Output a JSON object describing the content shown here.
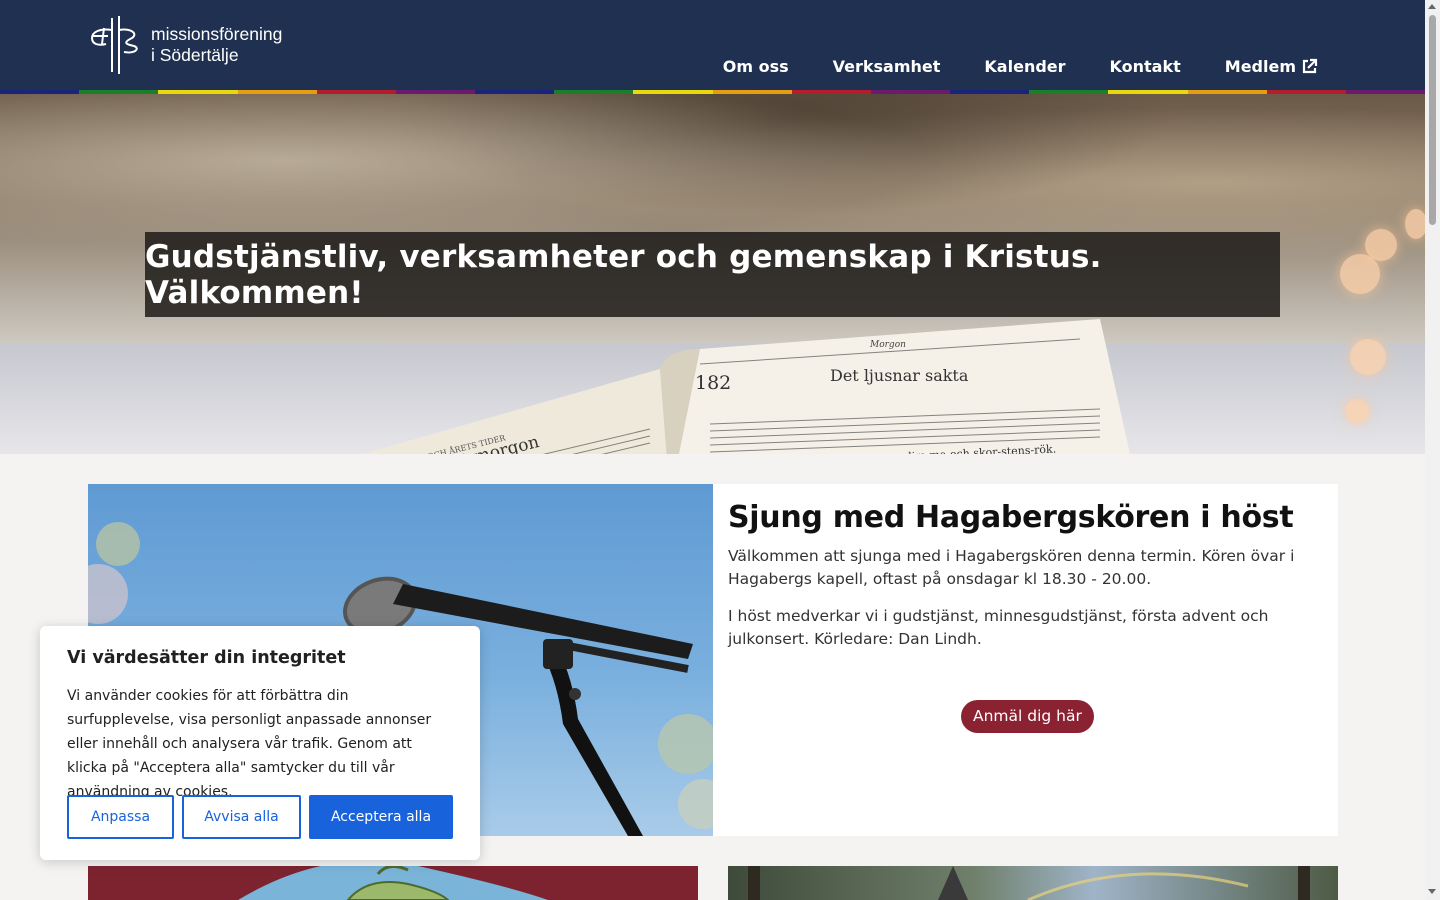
{
  "header": {
    "logo_line1": "missionsförening",
    "logo_line2": "i Södertälje",
    "nav": [
      "Om oss",
      "Verksamhet",
      "Kalender",
      "Kontakt",
      "Medlem"
    ],
    "rainbow_colors": [
      "#1a237e",
      "#1b7f2a",
      "#e9d80d",
      "#e59d12",
      "#b21e2b",
      "#6a1b6e",
      "#1a237e",
      "#1b7f2a",
      "#e9d80d",
      "#e59d12",
      "#b21e2b",
      "#6a1b6e",
      "#1a237e",
      "#1b7f2a",
      "#e9d80d",
      "#e59d12",
      "#b21e2b",
      "#6a1b6e"
    ]
  },
  "hero": {
    "headline": "Gudstjänstliv, verksamheter och gemenskap i Kristus. Välkommen!",
    "book_left_heading": "DAGENS OCH ÅRETS TIDER",
    "book_left_title": "Nu är det morgon",
    "book_right_number": "182",
    "book_right_label": "Morgon",
    "book_right_title": "Det ljusnar sakta",
    "book_right_lyric": "Det ljus-nar sak - ta i-ge-nom dim-ma och skor-stens-rök."
  },
  "feature": {
    "title": "Sjung med Hagabergskören i höst",
    "p1": "Välkommen att sjunga med i Hagabergskören denna termin. Kören övar i Hagabergs kapell, oftast på onsdagar kl 18.30 - 20.00.",
    "p2": "I höst medverkar vi i gudstjänst, minnesgudstjänst, första advent och julkonsert. Körledare: Dan Lindh.",
    "button": "Anmäl dig här"
  },
  "cookie": {
    "title": "Vi värdesätter din integritet",
    "text": "Vi använder cookies för att förbättra din surfupplevelse, visa personligt anpassade annonser eller innehåll och analysera vår trafik. Genom att klicka på \"Acceptera alla\" samtycker du till vår användning av cookies.",
    "btn_customize": "Anpassa",
    "btn_reject": "Avvisa alla",
    "btn_accept": "Acceptera alla"
  },
  "colors": {
    "header_bg": "#1f3050",
    "accent_button": "#8a2232",
    "cookie_blue": "#1863dc"
  }
}
